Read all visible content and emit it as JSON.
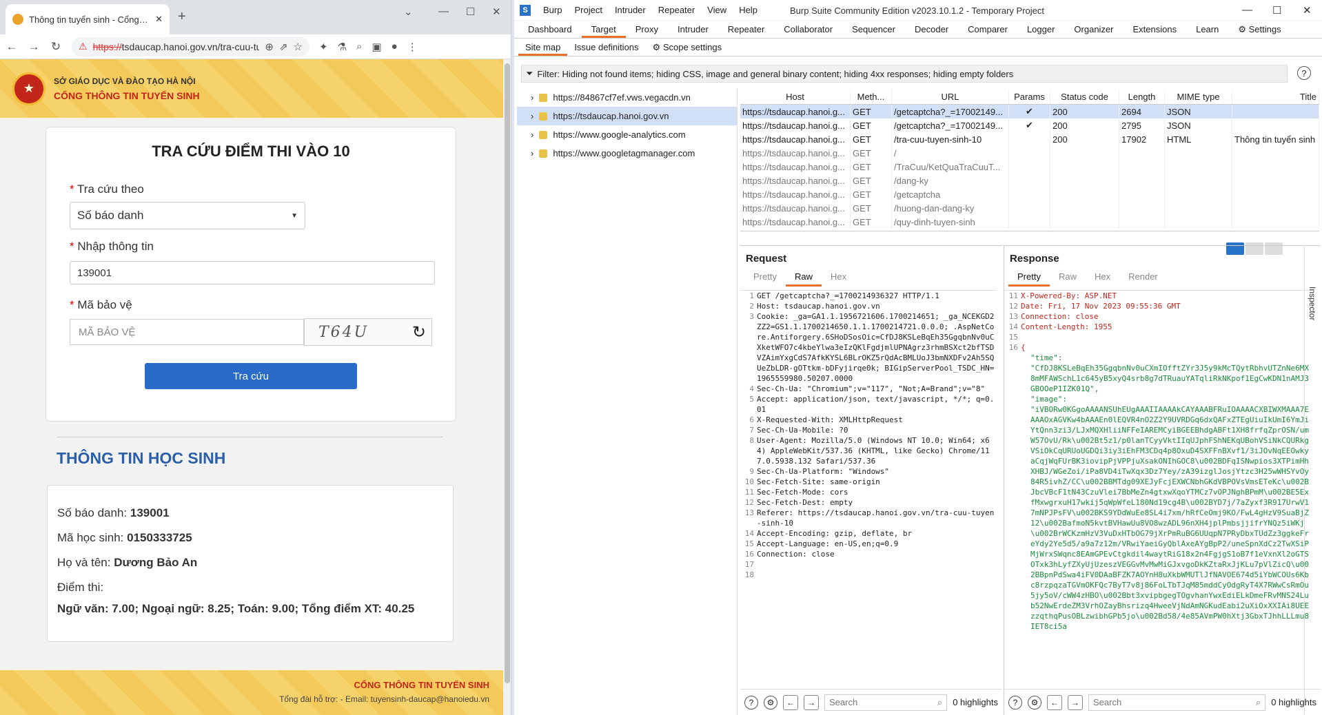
{
  "browser": {
    "tab_title": "Thông tin tuyển sinh - Cổng thô",
    "url_scheme": "https://",
    "url_rest": "tsdaucap.hanoi.gov.vn/tra-cuu-tuyen-..."
  },
  "site": {
    "header_line1": "SỞ GIÁO DỤC VÀ ĐÀO TẠO HÀ NỘI",
    "header_line2": "CỔNG THÔNG TIN TUYỂN SINH",
    "form_title": "TRA CỨU ĐIỂM THI VÀO 10",
    "label_lookup_by": "Tra cứu theo",
    "lookup_by_value": "Số báo danh",
    "label_input": "Nhập thông tin",
    "input_value": "139001",
    "label_captcha": "Mã bảo vệ",
    "captcha_placeholder": "MÃ BẢO VỆ",
    "captcha_text": "T64U",
    "submit_label": "Tra cứu",
    "section_title": "THÔNG TIN HỌC SINH",
    "sbd_label": "Số báo danh: ",
    "sbd_value": "139001",
    "mhs_label": "Mã học sinh: ",
    "mhs_value": "0150333725",
    "name_label": "Họ và tên: ",
    "name_value": "Dương Bảo An",
    "score_label": "Điểm thi:",
    "scores": "Ngữ văn: 7.00; Ngoại ngữ: 8.25; Toán: 9.00; Tổng điểm XT: 40.25",
    "footer_title": "CỔNG THÔNG TIN TUYỂN SINH",
    "footer_contact": "Tổng đài hỗ trợ: - Email: tuyensinh-daucap@hanoiedu.vn"
  },
  "burp": {
    "menus": [
      "Burp",
      "Project",
      "Intruder",
      "Repeater",
      "View",
      "Help"
    ],
    "title": "Burp Suite Community Edition v2023.10.1.2 - Temporary Project",
    "main_tabs": [
      "Dashboard",
      "Target",
      "Proxy",
      "Intruder",
      "Repeater",
      "Collaborator",
      "Sequencer",
      "Decoder",
      "Comparer",
      "Logger",
      "Organizer",
      "Extensions",
      "Learn"
    ],
    "settings_label": "Settings",
    "sub_tabs": [
      "Site map",
      "Issue definitions"
    ],
    "scope_label": "Scope settings",
    "filter": "Filter: Hiding not found items;  hiding CSS, image and general binary content;  hiding 4xx responses;  hiding empty folders",
    "hosts": [
      "https://84867cf7ef.vws.vegacdn.vn",
      "https://tsdaucap.hanoi.gov.vn",
      "https://www.google-analytics.com",
      "https://www.googletagmanager.com"
    ],
    "columns": [
      "Host",
      "Meth...",
      "URL",
      "Params",
      "Status code",
      "Length",
      "MIME type",
      "Title"
    ],
    "rows": [
      [
        "https://tsdaucap.hanoi.g...",
        "GET",
        "/getcaptcha?_=17002149...",
        "✔",
        "200",
        "2694",
        "JSON",
        ""
      ],
      [
        "https://tsdaucap.hanoi.g...",
        "GET",
        "/getcaptcha?_=17002149...",
        "✔",
        "200",
        "2795",
        "JSON",
        ""
      ],
      [
        "https://tsdaucap.hanoi.g...",
        "GET",
        "/tra-cuu-tuyen-sinh-10",
        "",
        "200",
        "17902",
        "HTML",
        "Thông tin tuyển sinh"
      ],
      [
        "https://tsdaucap.hanoi.g...",
        "GET",
        "/",
        "",
        "",
        "",
        "",
        ""
      ],
      [
        "https://tsdaucap.hanoi.g...",
        "GET",
        "/TraCuu/KetQuaTraCuuT...",
        "",
        "",
        "",
        "",
        ""
      ],
      [
        "https://tsdaucap.hanoi.g...",
        "GET",
        "/dang-ky",
        "",
        "",
        "",
        "",
        ""
      ],
      [
        "https://tsdaucap.hanoi.g...",
        "GET",
        "/getcaptcha",
        "",
        "",
        "",
        "",
        ""
      ],
      [
        "https://tsdaucap.hanoi.g...",
        "GET",
        "/huong-dan-dang-ky",
        "",
        "",
        "",
        "",
        ""
      ],
      [
        "https://tsdaucap.hanoi.g...",
        "GET",
        "/quy-dinh-tuyen-sinh",
        "",
        "",
        "",
        "",
        ""
      ]
    ],
    "request_title": "Request",
    "response_title": "Response",
    "req_tabs": [
      "Pretty",
      "Raw",
      "Hex"
    ],
    "resp_tabs": [
      "Pretty",
      "Raw",
      "Hex",
      "Render"
    ],
    "search_placeholder": "Search",
    "highlights": "0 highlights",
    "inspector": "Inspector",
    "request_lines": [
      [
        "1",
        "GET /getcaptcha?_=1700214936327 HTTP/1.1"
      ],
      [
        "2",
        "Host: tsdaucap.hanoi.gov.vn"
      ],
      [
        "3",
        "Cookie: _ga=GA1.1.1956721606.1700214651; _ga_NCEKGD2ZZ2=GS1.1.1700214650.1.1.1700214721.0.0.0; .AspNetCore.Antiforgery.6SHoDSosOic=CfDJ8KSLeBqEh35GgqbnNv0uCXketWFO7c4kbeYlwa3eIzQKlFgdjmlUPNAgrz3rhmBSXct2bfTSDVZAimYxgCdS7AfkKYSL6BLrOKZ5rQdAcBMLUoJ3bmNXDFv2Ah5SQUeZbLDR-gOTtkm-bDFyjirqe0k; BIGipServerPool_TSDC_HN=1965559980.50207.0000"
      ],
      [
        "4",
        "Sec-Ch-Ua: \"Chromium\";v=\"117\", \"Not;A=Brand\";v=\"8\""
      ],
      [
        "5",
        "Accept: application/json, text/javascript, */*; q=0.01"
      ],
      [
        "6",
        "X-Requested-With: XMLHttpRequest"
      ],
      [
        "7",
        "Sec-Ch-Ua-Mobile: ?0"
      ],
      [
        "8",
        "User-Agent: Mozilla/5.0 (Windows NT 10.0; Win64; x64) AppleWebKit/537.36 (KHTML, like Gecko) Chrome/117.0.5938.132 Safari/537.36"
      ],
      [
        "9",
        "Sec-Ch-Ua-Platform: \"Windows\""
      ],
      [
        "10",
        "Sec-Fetch-Site: same-origin"
      ],
      [
        "11",
        "Sec-Fetch-Mode: cors"
      ],
      [
        "12",
        "Sec-Fetch-Dest: empty"
      ],
      [
        "13",
        "Referer: https://tsdaucap.hanoi.gov.vn/tra-cuu-tuyen-sinh-10"
      ],
      [
        "14",
        "Accept-Encoding: gzip, deflate, br"
      ],
      [
        "15",
        "Accept-Language: en-US,en;q=0.9"
      ],
      [
        "16",
        "Connection: close"
      ],
      [
        "17",
        ""
      ],
      [
        "18",
        ""
      ]
    ],
    "response_lines": [
      [
        "11",
        "X-Powered-By: ASP.NET"
      ],
      [
        "12",
        "Date: Fri, 17 Nov 2023 09:55:36 GMT"
      ],
      [
        "13",
        "Connection: close"
      ],
      [
        "14",
        "Content-Length: 1955"
      ],
      [
        "15",
        ""
      ],
      [
        "16",
        "{"
      ]
    ],
    "response_json": "\"time\":\n\"CfDJ8KSLeBqEh35GgqbnNv0uCXmIOfftZYr3J5y9kMcTQytRbhvUTZnNe6MX8mMFAWSchL1c645yB5xyQ4srb8g7dTRuauYATqliRkNKpof1EgCwKDN1nAMJ3GBOOeP1IZK01Q\",\n\"image\":\n\"iVBORw0KGgoAAAANSUhEUgAAAIIAAAAkCAYAAABFRuIOAAAACXBIWXMAAA7EAAAOxAGVKw4bAAAEn0lEQVR4nO2Z2Y9UVRDGq6dxQAFxZTEgUiuIkUmI6YmJiYtQnn3zi3/LJxMQXHliiNFFeIAREMCyiBGEEBhdgABFt1XH8frfqZprOSN/umW57OvU/Rk\\u002Bt5z1/p0lanTCyyVktIIqUJphFShNEKqUBohVSiNkCQURkgVSiOkCqURUoUGDQi3iy3iEhFM3CDq4p8OxuD4SXFFnBXvf1/3iJOvNqEEOwkyaCqjWqFUrBK3iovipPjVPPjuXsakONIhGOC8\\u002BDFqISNwpios3XTPimHhXHBJ/WGeZoi/iPa8VD4iTwXqx3Dz7Yey/zA39izglJosjYtzc3H25wWHSYvOy84R5ivhZ/CC\\u002BBMTdg09XEJyFcjEXWCNbhGKdVBPOVsVmsETeKc\\u002BJbcVBcF1tN43CzuVlei7BbMeZn4gtxwXqoYTMCz7vOPJNghBPmM\\u002BE5ExfMxwgrxuH17wkij5qWpWfeL180Nd19cg4B\\u002BYD7j/7aZyxf3R917UrwV17mNPJPsFV\\u002BKS9YDdWuEe8SL4i7xm/hRfCeOmj9KO/FwL4gHzV9SuaBjZ12\\u002BafmoN5kvtBVHawUu8VO8wzADL96nXH4jplPmbsjjifrYNQz5iWKj\\u002BrWCKzmHzV3VuDxHTbOG79jXrPmRuBG6UUqpN7PRyDbxTUdZz3ggkeFreYdy2Ye5d5/a9a7z12m/VRwiYaeiGyQblAxeAYgBpP2/uneSpnXdCz2TwXSiPMjWrxSWqnc8EAmGPEvCtgkdil4waytRiG18x2n4FgjgS1oB7f1eVxnXl2oGTSOTxk3hLyfZXyUjUzeszVEGGvMvMwMiGJxvgoDkKZtaRxJjKLu7pVlZicQ\\u002BBpnPdSwa4iFV0DAaBFZK7AOYnH8uXkbWMUTlJfNAVOE674d5iYbWCOUs6Kbc8rzpqzaTGVmOKFQc7ByT7v8j86FoLTbTJqM85mddCyOdgRyT4X7RWwCsRmOu5jy5oV/cWW4zHBO\\u002Bbt3xvipbgegTOgvhanYwxEdiELkDmeFRvMNS24Lub52NwErdeZM3VrhOZayBhsrizq4HweeVjNdAmNGKudEabi2uXiOxXXIAi8UEEzzqthqPusOBLzwibhGPb5jo\\u002Bd58/4e85AVmPW0hXtj3GbxTJhhLLLmu8IET8ci5a"
  }
}
